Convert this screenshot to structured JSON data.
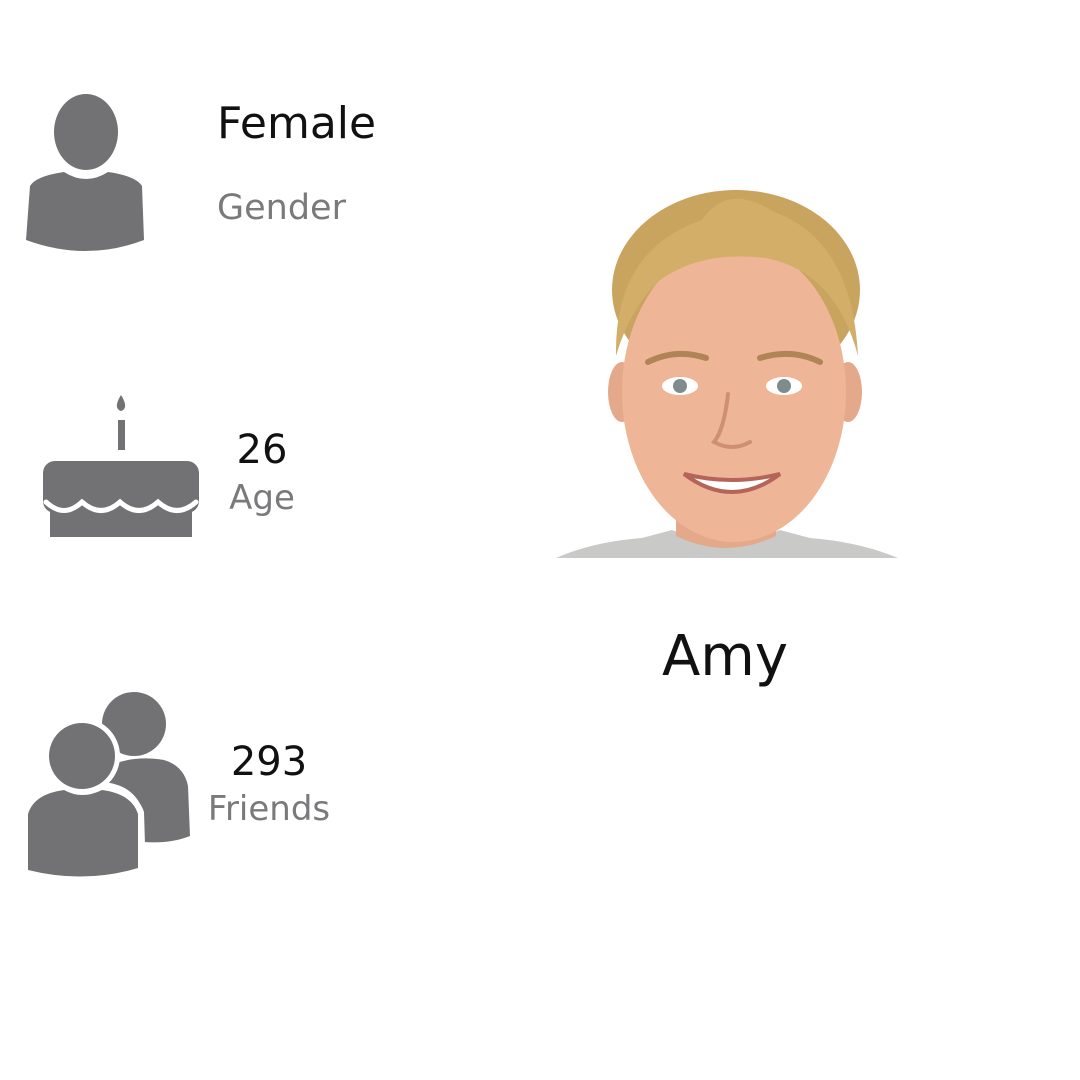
{
  "colors": {
    "icon_gray": "#727274",
    "caption_gray": "#7a7a7c",
    "text_dark": "#111111",
    "background": "#ffffff"
  },
  "profile": {
    "name": "Amy",
    "photo_icon": "portrait-photo"
  },
  "stats": {
    "gender": {
      "icon": "person-icon",
      "value": "Female",
      "caption": "Gender"
    },
    "age": {
      "icon": "birthday-cake-icon",
      "value": "26",
      "caption": "Age"
    },
    "friends": {
      "icon": "group-icon",
      "value": "293",
      "caption": "Friends"
    }
  }
}
